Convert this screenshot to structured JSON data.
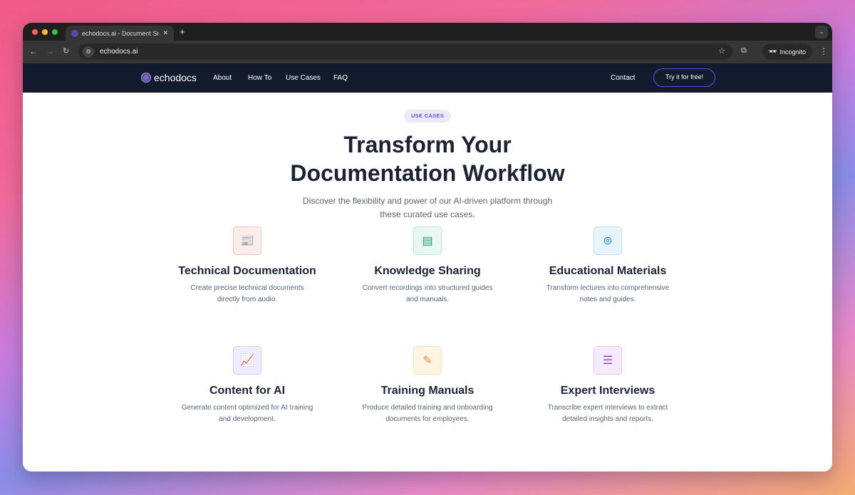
{
  "browser": {
    "tab_title": "echodocs.ai - Document Sma",
    "url": "echodocs.ai",
    "incognito_label": "Incognito"
  },
  "nav": {
    "brand": "echodocs",
    "links": [
      "About",
      "How To",
      "Use Cases",
      "FAQ"
    ],
    "contact": "Contact",
    "cta": "Try it for free!"
  },
  "hero": {
    "badge": "USE CASES",
    "title_line1": "Transform Your",
    "title_line2": "Documentation Workflow",
    "subtitle_line1": "Discover the flexibility and power of our AI-driven platform through",
    "subtitle_line2": "these curated use cases."
  },
  "cards": [
    {
      "title": "Technical Documentation",
      "desc": "Create precise technical documents directly from audio.",
      "icon": "newspaper-icon",
      "color": "#c0392b",
      "bg": "#fdecec"
    },
    {
      "title": "Knowledge Sharing",
      "desc": "Convert recordings into structured guides and manuals.",
      "icon": "archive-box-icon",
      "color": "#2e9a6e",
      "bg": "#e8f7f0"
    },
    {
      "title": "Educational Materials",
      "desc": "Transform lectures into comprehensive notes and guides.",
      "icon": "hands-holding-icon",
      "color": "#2a8fd0",
      "bg": "#e6f4fd"
    },
    {
      "title": "Content for AI",
      "desc": "Generate content optimized for AI training and development.",
      "icon": "chart-growth-icon",
      "color": "#5b4ee6",
      "bg": "#efedfd"
    },
    {
      "title": "Training Manuals",
      "desc": "Produce detailed training and onboarding documents for employees.",
      "icon": "pen-document-icon",
      "color": "#f0893a",
      "bg": "#fff5e3"
    },
    {
      "title": "Expert Interviews",
      "desc": "Transcribe expert interviews to extract detailed insights and reports.",
      "icon": "browser-window-icon",
      "color": "#9b3fd4",
      "bg": "#f6eafd"
    }
  ]
}
